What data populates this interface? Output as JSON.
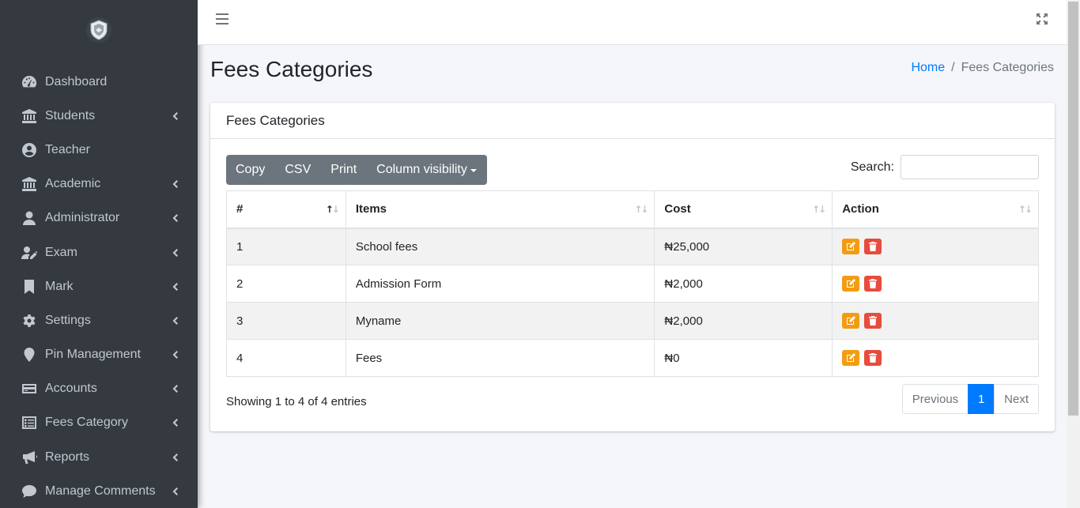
{
  "sidebar": {
    "items": [
      {
        "label": "Dashboard",
        "icon": "tachometer-icon",
        "has_children": false
      },
      {
        "label": "Students",
        "icon": "university-icon",
        "has_children": true
      },
      {
        "label": "Teacher",
        "icon": "user-circle-icon",
        "has_children": false
      },
      {
        "label": "Academic",
        "icon": "university-icon",
        "has_children": true
      },
      {
        "label": "Administrator",
        "icon": "user-icon",
        "has_children": true
      },
      {
        "label": "Exam",
        "icon": "user-edit-icon",
        "has_children": true
      },
      {
        "label": "Mark",
        "icon": "bookmark-icon",
        "has_children": true
      },
      {
        "label": "Settings",
        "icon": "gear-icon",
        "has_children": true
      },
      {
        "label": "Pin Management",
        "icon": "map-marker-icon",
        "has_children": true
      },
      {
        "label": "Accounts",
        "icon": "credit-card-icon",
        "has_children": true
      },
      {
        "label": "Fees Category",
        "icon": "list-alt-icon",
        "has_children": true
      },
      {
        "label": "Reports",
        "icon": "bullhorn-icon",
        "has_children": true
      },
      {
        "label": "Manage Comments",
        "icon": "comment-icon",
        "has_children": true
      }
    ]
  },
  "header": {
    "title": "Fees Categories",
    "breadcrumb": {
      "home": "Home",
      "separator": "/",
      "current": "Fees Categories"
    }
  },
  "card": {
    "title": "Fees Categories",
    "buttons": {
      "copy": "Copy",
      "csv": "CSV",
      "print": "Print",
      "column_visibility": "Column visibility"
    },
    "search": {
      "label": "Search:",
      "value": "",
      "placeholder": ""
    }
  },
  "table": {
    "headers": [
      "#",
      "Items",
      "Cost",
      "Action"
    ],
    "rows": [
      {
        "num": "1",
        "item": "School fees",
        "cost": "₦25,000"
      },
      {
        "num": "2",
        "item": "Admission Form",
        "cost": "₦2,000"
      },
      {
        "num": "3",
        "item": "Myname",
        "cost": "₦2,000"
      },
      {
        "num": "4",
        "item": "Fees",
        "cost": "₦0"
      }
    ]
  },
  "footer": {
    "info": "Showing 1 to 4 of 4 entries",
    "pagination": {
      "previous": "Previous",
      "current": "1",
      "next": "Next"
    }
  },
  "colors": {
    "sidebar_bg": "#343a40",
    "primary": "#007bff",
    "edit": "#f39c12",
    "delete": "#e74c3c"
  }
}
